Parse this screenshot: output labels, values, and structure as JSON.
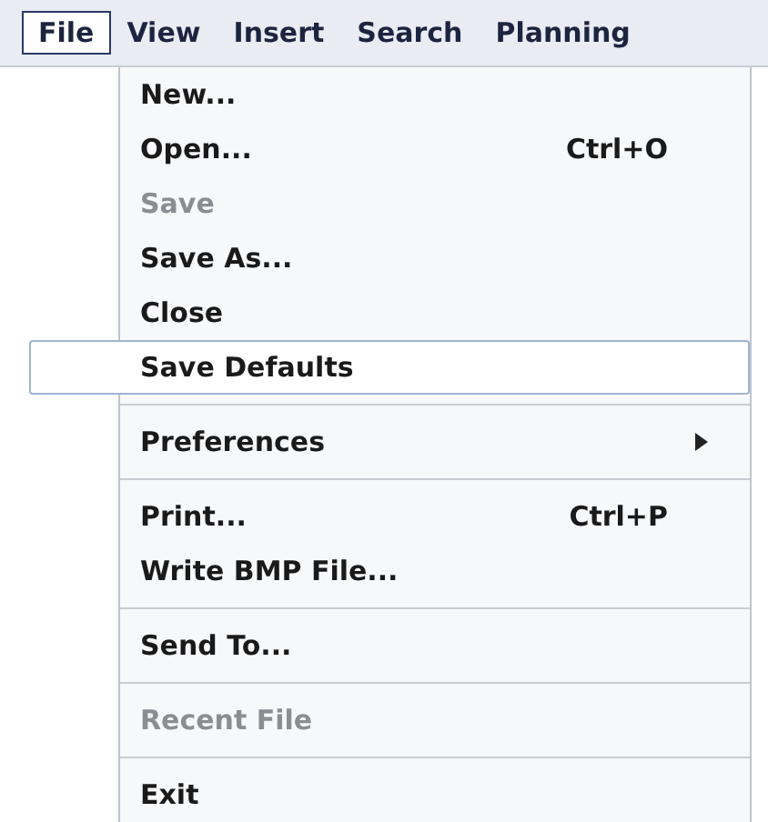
{
  "menu_bar": [
    {
      "label": "File",
      "selected": true
    },
    {
      "label": "View",
      "selected": false
    },
    {
      "label": "Insert",
      "selected": false
    },
    {
      "label": "Search",
      "selected": false
    },
    {
      "label": "Planning",
      "selected": false
    }
  ],
  "menu": [
    {
      "kind": "item",
      "label": "New...",
      "disabled": false,
      "selected": false
    },
    {
      "kind": "item",
      "label": "Open...",
      "shortcut": "Ctrl+O",
      "disabled": false,
      "selected": false
    },
    {
      "kind": "item",
      "label": "Save",
      "disabled": true,
      "selected": false
    },
    {
      "kind": "item",
      "label": "Save As...",
      "disabled": false,
      "selected": false
    },
    {
      "kind": "item",
      "label": "Close",
      "disabled": false,
      "selected": false
    },
    {
      "kind": "item",
      "label": "Save Defaults",
      "disabled": false,
      "selected": true
    },
    {
      "kind": "separator"
    },
    {
      "kind": "submenu",
      "label": "Preferences",
      "disabled": false,
      "selected": false
    },
    {
      "kind": "separator"
    },
    {
      "kind": "item",
      "label": "Print...",
      "shortcut": "Ctrl+P",
      "disabled": false,
      "selected": false
    },
    {
      "kind": "item",
      "label": "Write BMP File...",
      "disabled": false,
      "selected": false
    },
    {
      "kind": "separator"
    },
    {
      "kind": "item",
      "label": "Send To...",
      "disabled": false,
      "selected": false
    },
    {
      "kind": "separator"
    },
    {
      "kind": "item",
      "label": "Recent File",
      "disabled": true,
      "selected": false
    },
    {
      "kind": "separator"
    },
    {
      "kind": "item",
      "label": "Exit",
      "disabled": false,
      "selected": false
    }
  ]
}
